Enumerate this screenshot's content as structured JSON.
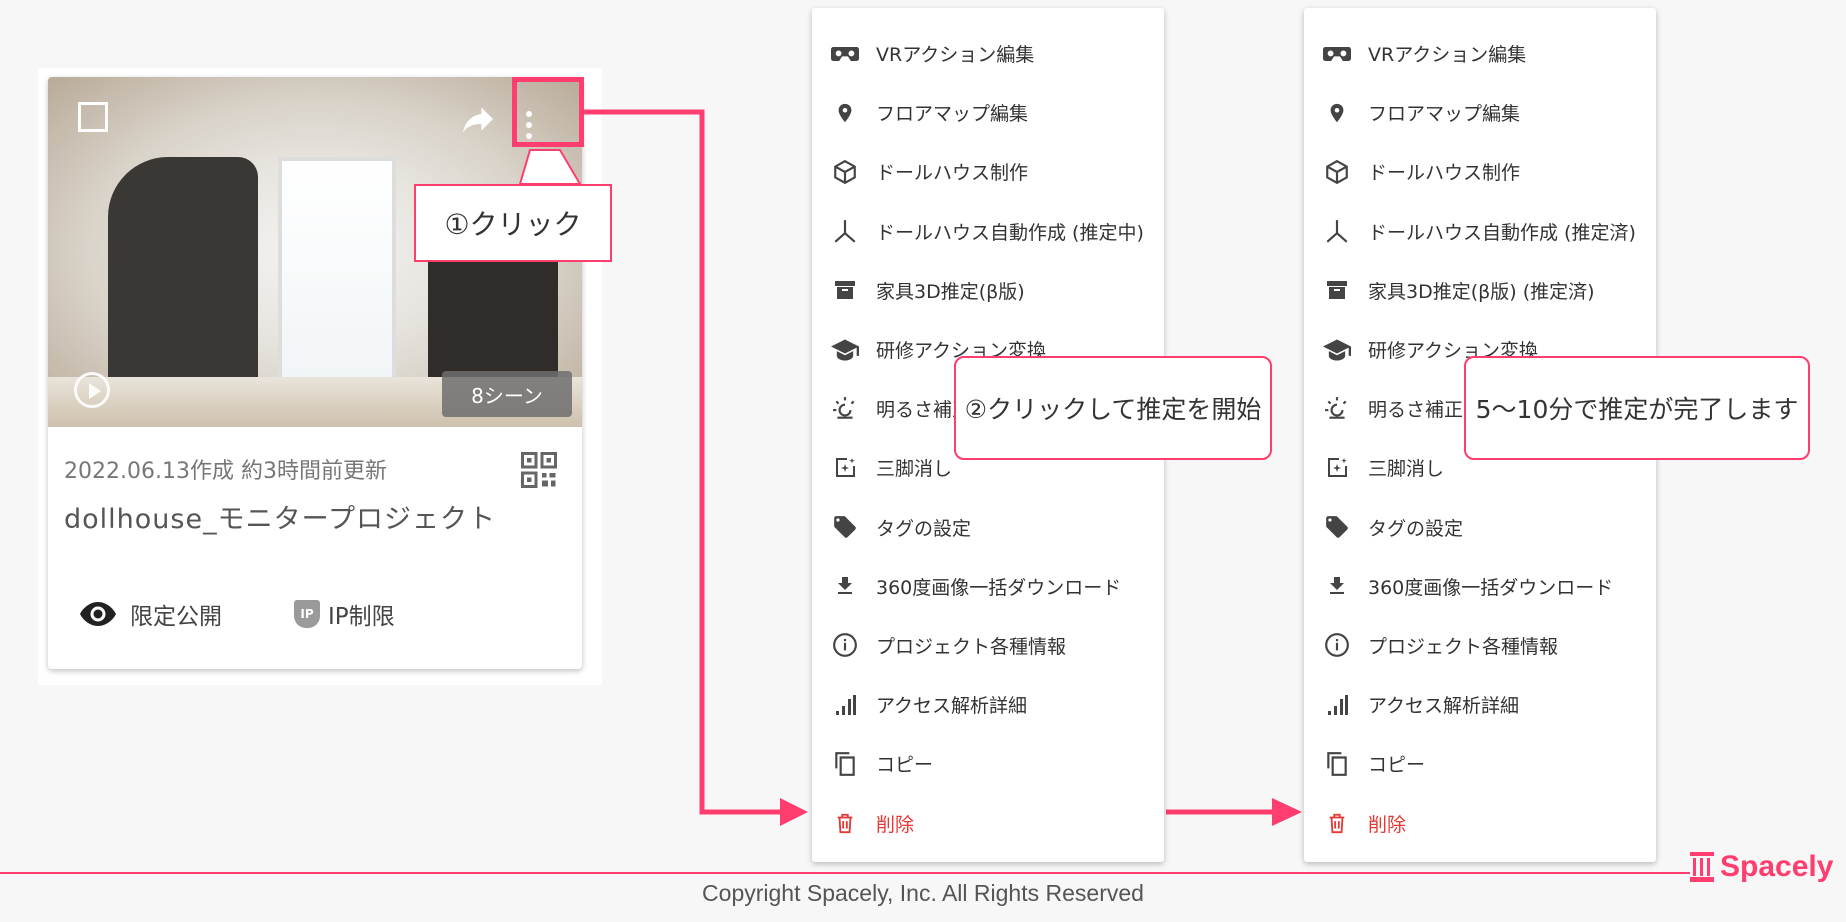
{
  "card": {
    "scene_count": "8シーン",
    "meta": "2022.06.13作成 約3時間前更新",
    "title": "dollhouse_モニタープロジェクト",
    "visibility_label": "限定公開",
    "ip_badge": "IP",
    "ip_label": "IP制限"
  },
  "callouts": {
    "step1": "①クリック",
    "step2": "②クリックして推定を開始",
    "step3": "5〜10分で推定が完了します"
  },
  "menu_left": {
    "items": [
      {
        "label": "VRアクション編集",
        "icon": "vr-headset-icon"
      },
      {
        "label": "フロアマップ編集",
        "icon": "map-pin-icon"
      },
      {
        "label": "ドールハウス制作",
        "icon": "cube-icon"
      },
      {
        "label": "ドールハウス自動作成 (推定中)",
        "icon": "axis-icon"
      },
      {
        "label": "家具3D推定(β版)",
        "icon": "archive-icon"
      },
      {
        "label": "研修アクション変換",
        "icon": "graduation-cap-icon"
      },
      {
        "label": "明るさ補正",
        "icon": "brightness-icon"
      },
      {
        "label": "三脚消し",
        "icon": "sparkle-edit-icon"
      },
      {
        "label": "タグの設定",
        "icon": "tag-icon"
      },
      {
        "label": "360度画像一括ダウンロード",
        "icon": "download-icon"
      },
      {
        "label": "プロジェクト各種情報",
        "icon": "info-icon"
      },
      {
        "label": "アクセス解析詳細",
        "icon": "signal-bars-icon"
      },
      {
        "label": "コピー",
        "icon": "copy-icon"
      },
      {
        "label": "削除",
        "icon": "trash-icon"
      }
    ]
  },
  "menu_right": {
    "items": [
      {
        "label": "VRアクション編集",
        "icon": "vr-headset-icon"
      },
      {
        "label": "フロアマップ編集",
        "icon": "map-pin-icon"
      },
      {
        "label": "ドールハウス制作",
        "icon": "cube-icon"
      },
      {
        "label": "ドールハウス自動作成 (推定済)",
        "icon": "axis-icon"
      },
      {
        "label": "家具3D推定(β版) (推定済)",
        "icon": "archive-icon"
      },
      {
        "label": "研修アクション変換",
        "icon": "graduation-cap-icon"
      },
      {
        "label": "明るさ補正",
        "icon": "brightness-icon"
      },
      {
        "label": "三脚消し",
        "icon": "sparkle-edit-icon"
      },
      {
        "label": "タグの設定",
        "icon": "tag-icon"
      },
      {
        "label": "360度画像一括ダウンロード",
        "icon": "download-icon"
      },
      {
        "label": "プロジェクト各種情報",
        "icon": "info-icon"
      },
      {
        "label": "アクセス解析詳細",
        "icon": "signal-bars-icon"
      },
      {
        "label": "コピー",
        "icon": "copy-icon"
      },
      {
        "label": "削除",
        "icon": "trash-icon"
      }
    ]
  },
  "footer": {
    "copyright": "Copyright Spacely, Inc. All Rights Reserved",
    "logo": "Spacely"
  },
  "colors": {
    "accent": "#ff3d6e",
    "danger": "#e53935"
  }
}
